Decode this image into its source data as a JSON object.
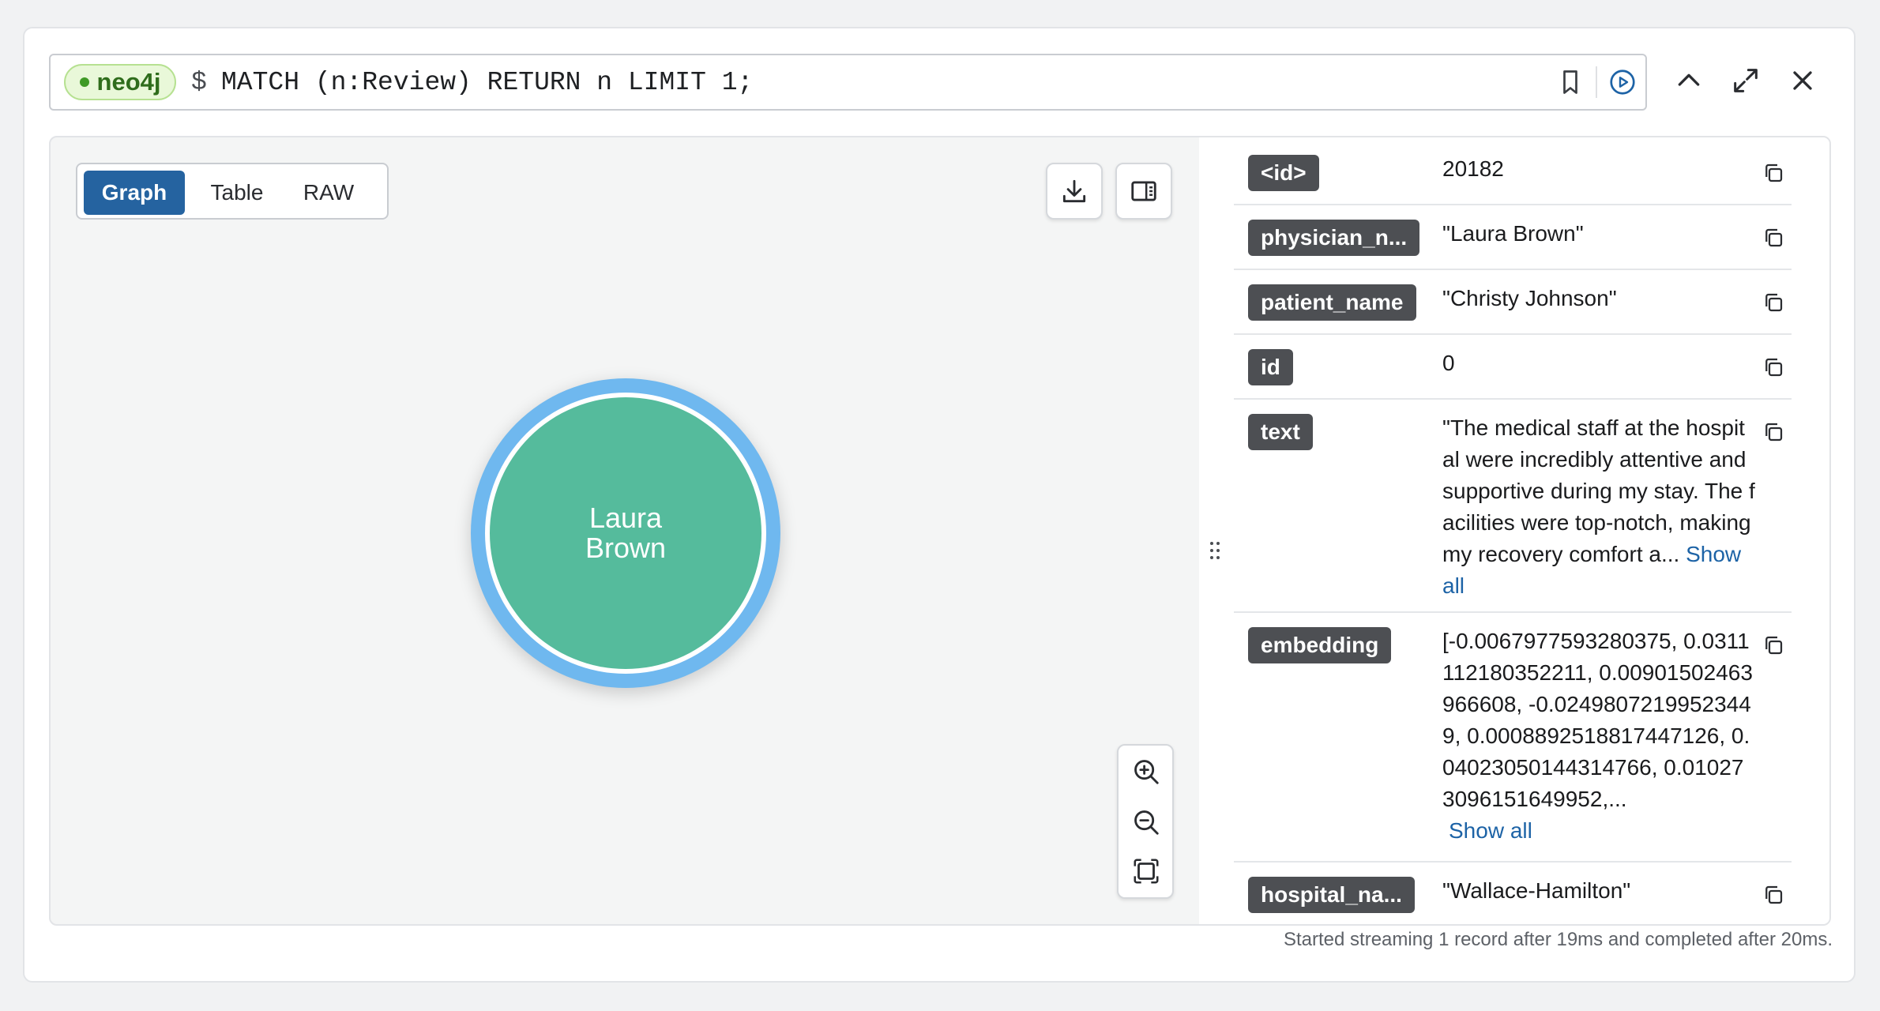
{
  "editor": {
    "database": "neo4j",
    "prompt": "$",
    "query": "MATCH (n:Review) RETURN n LIMIT 1;"
  },
  "view_tabs": [
    {
      "label": "Graph",
      "active": true
    },
    {
      "label": "Table",
      "active": false
    },
    {
      "label": "RAW",
      "active": false
    }
  ],
  "node": {
    "label_line1": "Laura",
    "label_line2": "Brown",
    "fill_color": "#55bb9c",
    "ring_color": "#6fb8ef"
  },
  "properties": [
    {
      "key": "<id>",
      "value": "20182"
    },
    {
      "key": "physician_n...",
      "value": "\"Laura Brown\""
    },
    {
      "key": "patient_name",
      "value": "\"Christy Johnson\""
    },
    {
      "key": "id",
      "value": "0"
    },
    {
      "key": "text",
      "value": "\"The medical staff at the hospital were incredibly attentive and supportive during my stay. The facilities were top-notch, making my recovery comfort a...",
      "link": "Show all"
    },
    {
      "key": "embedding",
      "value": "[-0.0067977593280375, 0.0311112180352211, 0.00901502463966608, -0.02498072199523449, 0.0008892518817447126, 0.04023050144314766, 0.010273096151649952,...",
      "link": "Show all"
    },
    {
      "key": "hospital_na...",
      "value": "\"Wallace-Hamilton\""
    }
  ],
  "status": "Started streaming 1 record after 19ms and completed after 20ms.",
  "colors": {
    "accent": "#2563a0",
    "key_badge": "#4d4f53",
    "link": "#1d63a6"
  },
  "icons": [
    "bookmark-icon",
    "run-icon",
    "chevron-up-icon",
    "expand-icon",
    "close-icon",
    "download-icon",
    "panel-toggle-icon",
    "zoom-in-icon",
    "zoom-out-icon",
    "fit-icon",
    "copy-icon",
    "drag-handle-icon"
  ]
}
